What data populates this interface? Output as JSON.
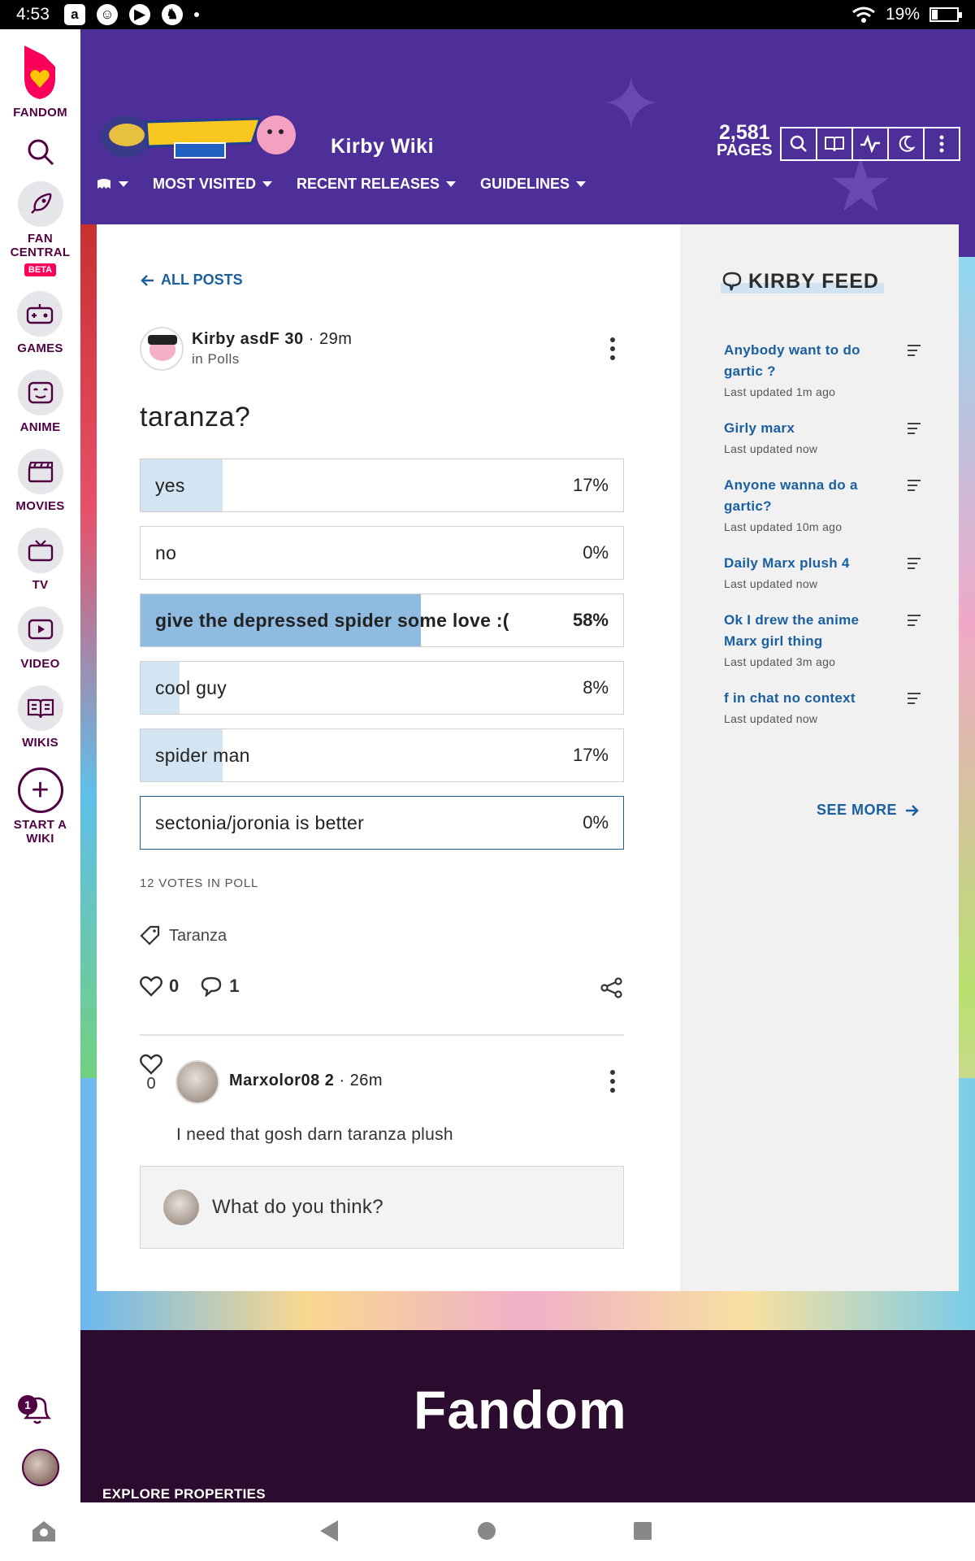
{
  "status": {
    "time": "4:53",
    "battery": "19%"
  },
  "rail": {
    "brand": "FANDOM",
    "items": [
      {
        "label": "FAN CENTRAL",
        "badge": "BETA"
      },
      {
        "label": "GAMES"
      },
      {
        "label": "ANIME"
      },
      {
        "label": "MOVIES"
      },
      {
        "label": "TV"
      },
      {
        "label": "VIDEO"
      },
      {
        "label": "WIKIS"
      }
    ],
    "start_wiki": "START A WIKI",
    "notification_count": "1"
  },
  "wiki": {
    "title": "Kirby Wiki",
    "pages_count": "2,581",
    "pages_label": "PAGES",
    "nav": [
      "MOST VISITED",
      "RECENT RELEASES",
      "GUIDELINES"
    ]
  },
  "post": {
    "back_label": "ALL POSTS",
    "author": "Kirby asdF 30",
    "time": "29m",
    "category": "in Polls",
    "title": "taranza?",
    "options": [
      {
        "label": "yes",
        "pct": "17%",
        "value": 17
      },
      {
        "label": "no",
        "pct": "0%",
        "value": 0
      },
      {
        "label": "give the depressed spider some love :(",
        "pct": "58%",
        "value": 58
      },
      {
        "label": "cool guy",
        "pct": "8%",
        "value": 8
      },
      {
        "label": "spider man",
        "pct": "17%",
        "value": 17
      },
      {
        "label": "sectonia/joronia is better",
        "pct": "0%",
        "value": 0
      }
    ],
    "votes": "12 VOTES IN POLL",
    "tag": "Taranza",
    "likes": "0",
    "comments": "1"
  },
  "reply": {
    "likes": "0",
    "author": "Marxolor08 2",
    "time": "26m",
    "text": "I need that gosh darn taranza plush"
  },
  "comment_placeholder": "What do you think?",
  "feed": {
    "title": "KIRBY FEED",
    "items": [
      {
        "title": "Anybody want to do gartic ?",
        "updated": "Last updated 1m ago"
      },
      {
        "title": "Girly marx",
        "updated": "Last updated now"
      },
      {
        "title": "Anyone wanna do a gartic?",
        "updated": "Last updated 10m ago"
      },
      {
        "title": "Daily Marx plush 4",
        "updated": "Last updated now"
      },
      {
        "title": "Ok I drew the anime Marx girl thing",
        "updated": "Last updated 3m ago"
      },
      {
        "title": "f in chat no context",
        "updated": "Last updated now"
      }
    ],
    "see_more": "SEE MORE"
  },
  "footer": {
    "brand": "Fandom",
    "explore": "EXPLORE PROPERTIES"
  },
  "colors": {
    "fandom_pink": "#fa005a",
    "fandom_plum": "#520044",
    "link_blue": "#1a5fa0",
    "poll_fill": "#d3e5f2",
    "poll_win": "#8fbbe0"
  }
}
